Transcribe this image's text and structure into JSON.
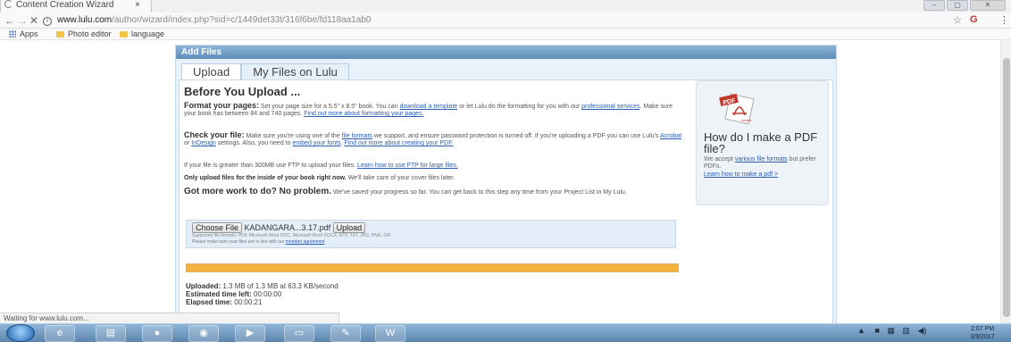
{
  "browser": {
    "tab_title": "Content Creation Wizard",
    "tab_close": "×",
    "url_domain": "www.lulu.com",
    "url_path": "/author/wizard/index.php?sid=c/1449det33t/316f6be/fd118aa1ab0",
    "bookmarks": [
      "Apps",
      "Photo editor",
      "language"
    ],
    "status_text": "Waiting for www.lulu.com..."
  },
  "panel": {
    "header": "Add Files",
    "tabs": [
      "Upload",
      "My Files on Lulu"
    ]
  },
  "content": {
    "heading": "Before You Upload ...",
    "format": {
      "label": "Format your pages:",
      "text1": "Set your page size for a 5.5\" x 8.5\" book. You can",
      "link1": "download a template",
      "text2": "or let Lulu do the formatting for you with our",
      "link2": "professional services",
      "text3": ". Make sure your book has between 84 and 740 pages.",
      "link3": "Find out more about formatting your pages."
    },
    "check": {
      "label": "Check your file:",
      "text1": "Make sure you're using one of the",
      "link1": "file formats",
      "text2": "we support, and ensure password protection is turned off. If you're uploading a PDF you can use Lulu's",
      "link2": "Acrobat",
      "text3": "or",
      "link3": "InDesign",
      "text4": "settings. Also, you need to",
      "link4": "embed your fonts",
      "text5": ".",
      "link5": "Find out more about creating your PDF."
    },
    "ftp": {
      "text": "If your file is greater than 300MB use FTP to upload your files.",
      "link": "Learn how to use FTP for large files."
    },
    "inside_only": {
      "bold": "Only upload files for the inside of your book right now.",
      "text": "We'll take care of your cover files later."
    },
    "more_work": {
      "bold": "Got more work to do? No problem.",
      "text": "We've saved your progress so far. You can get back to this step any time from your Project List in My Lulu."
    },
    "pdf_box": {
      "icon_label": "PDF",
      "brand": "Adobe",
      "title": "How do I make a PDF file?",
      "text1": "We accept",
      "link1": "various file formats",
      "text2": "but prefer PDFs.",
      "link2": "Learn how to make a pdf >"
    },
    "upload": {
      "choose_button": "Choose File",
      "file_name": "KADANGARA...3.17.pdf",
      "upload_button": "Upload",
      "supported": "Supported file formats: PDF, Microsoft Word DOC, Microsoft Word DOCX, RTF, TXT, JPG, PNG, GIF",
      "note": "Please make sure your files are in line with our",
      "note_link": "member agreement"
    },
    "progress_fraction": 1.0,
    "stats": {
      "uploaded_label": "Uploaded:",
      "uploaded_value": "1.3 MB of 1.3 MB at 63.3 KB/second",
      "eta_label": "Estimated time left:",
      "eta_value": "00:00:00",
      "elapsed_label": "Elapsed time:",
      "elapsed_value": "00:00:21"
    }
  },
  "taskbar": {
    "clock_time": "2:07 PM",
    "clock_date": "3/9/2017"
  },
  "colors": {
    "header_blue": "#5d8db9",
    "link_blue": "#2a5db0",
    "progress_orange": "#f4b23e",
    "taskbar_blue": "#5d86ad"
  }
}
